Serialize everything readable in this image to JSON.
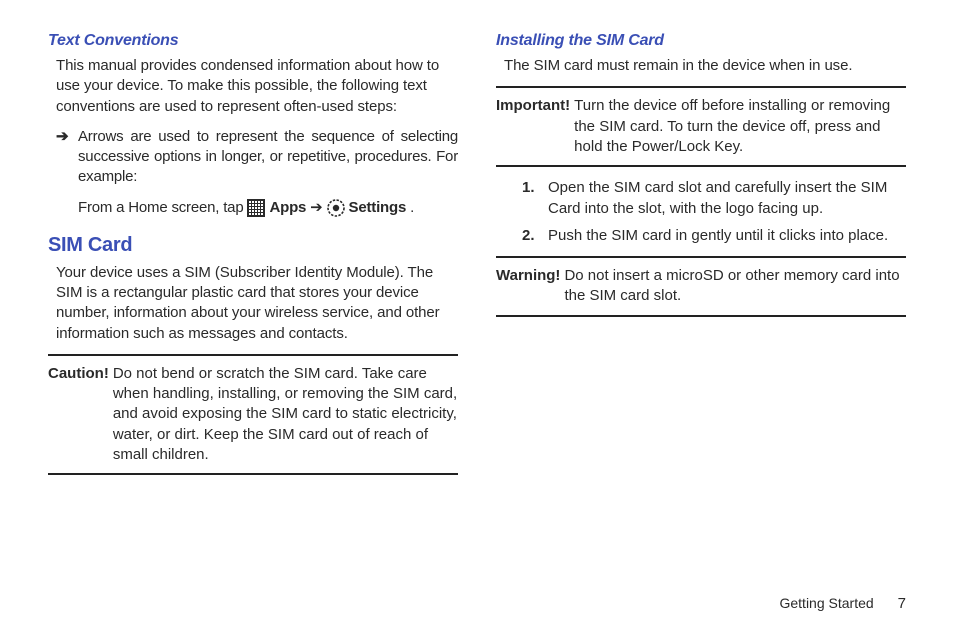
{
  "left": {
    "heading1": "Text Conventions",
    "intro": "This manual provides condensed information about how to use your device. To make this possible, the following text conventions are used to represent often-used steps:",
    "bullet_arrow": "➔",
    "bullet_text": "Arrows are used to represent the sequence of selecting successive options in longer, or repetitive, procedures. For example:",
    "example_prefix": "From a Home screen, tap ",
    "apps_label": "Apps",
    "arrow_sep": "➔",
    "settings_label": "Settings",
    "period": ".",
    "heading2": "SIM Card",
    "sim_body": "Your device uses a SIM (Subscriber Identity Module). The SIM is a rectangular plastic card that stores your device number, information about your wireless service, and other information such as messages and contacts.",
    "caution_label": "Caution!",
    "caution_body": "Do not bend or scratch the SIM card. Take care when handling, installing, or removing the SIM card, and avoid exposing the SIM card to static electricity, water, or dirt. Keep the SIM card out of reach of small children."
  },
  "right": {
    "heading1": "Installing the SIM Card",
    "intro": "The SIM card must remain in the device when in use.",
    "important_label": "Important!",
    "important_body": "Turn the device off before installing or removing the SIM card. To turn the device off, press and hold the Power/Lock Key.",
    "steps": [
      {
        "n": "1.",
        "t": "Open the SIM card slot and carefully insert the SIM Card into the slot, with the logo facing up."
      },
      {
        "n": "2.",
        "t": "Push the SIM card in gently until it clicks into place."
      }
    ],
    "warning_label": "Warning!",
    "warning_body": "Do not insert a microSD or other memory card into the SIM card slot."
  },
  "footer": {
    "section": "Getting Started",
    "page": "7"
  }
}
